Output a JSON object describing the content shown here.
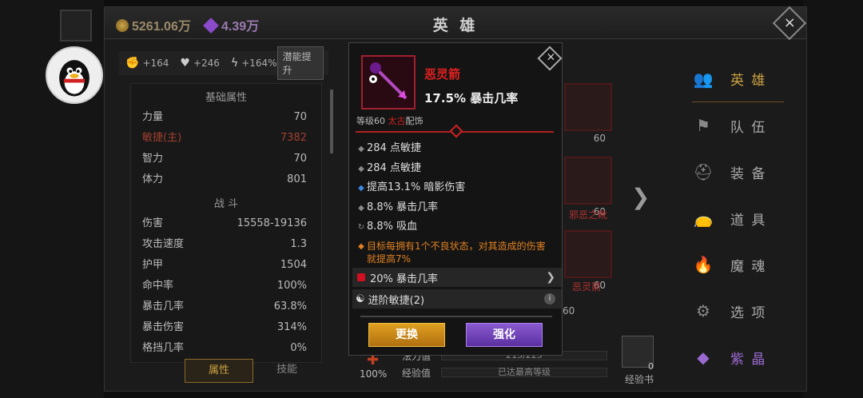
{
  "currency": {
    "gold": "5261.06万",
    "gems": "4.39万"
  },
  "header": {
    "title": "英 雄"
  },
  "stat_top": {
    "hp_bonus": "+164",
    "heart_bonus": "+246",
    "power_bonus": "+164%",
    "potential_button": "潜能提升"
  },
  "sections": {
    "basic": "基础属性",
    "battle": "战 斗"
  },
  "basic_stats": [
    {
      "name": "力量",
      "value": "70"
    },
    {
      "name": "敏捷(主)",
      "value": "7382"
    },
    {
      "name": "智力",
      "value": "70"
    },
    {
      "name": "体力",
      "value": "801"
    }
  ],
  "battle_stats": [
    {
      "name": "伤害",
      "value": "15558-19136"
    },
    {
      "name": "攻击速度",
      "value": "1.3"
    },
    {
      "name": "护甲",
      "value": "1504"
    },
    {
      "name": "命中率",
      "value": "100%"
    },
    {
      "name": "暴击几率",
      "value": "63.8%"
    },
    {
      "name": "暴击伤害",
      "value": "314%"
    },
    {
      "name": "格挡几率",
      "value": "0%"
    }
  ],
  "bottom_tabs": {
    "attributes": "属性",
    "skills": "技能"
  },
  "bg": {
    "slot_level": "60",
    "slot_name_1": "邪恶之靴",
    "slot_name_2": "恶灵箭",
    "pct": "100%",
    "mana_label": "法力值",
    "mana_value": "215/225",
    "exp_label": "经验值",
    "exp_value": "已达最高等级",
    "book_count": "0",
    "book_label": "经验书",
    "lower_lv": "60"
  },
  "menu": [
    {
      "label": "英 雄",
      "icon": "hero-icon"
    },
    {
      "label": "队 伍",
      "icon": "flag-icon"
    },
    {
      "label": "装 备",
      "icon": "helmet-icon"
    },
    {
      "label": "道 具",
      "icon": "bag-icon"
    },
    {
      "label": "魔 魂",
      "icon": "flame-icon"
    },
    {
      "label": "选 项",
      "icon": "gear-icon"
    },
    {
      "label": "紫 晶",
      "icon": "crystal-icon"
    }
  ],
  "item": {
    "name": "恶灵箭",
    "main_stat": "17.5% 暴击几率",
    "level_prefix": "等级60 ",
    "rarity": "太古",
    "slot": "配饰",
    "stats": [
      "284 点敏捷",
      "284 点敏捷",
      "提高13.1% 暗影伤害",
      "8.8% 暴击几率",
      "8.8% 吸血"
    ],
    "legendary": "目标每拥有1个不良状态，对其造成的伤害就提高7%",
    "gem": "20% 暴击几率",
    "advance": "进阶敏捷(2)",
    "swap_button": "更换",
    "upgrade_button": "强化"
  },
  "colors": {
    "rarity_red": "#d02020",
    "accent_gold": "#c9a040",
    "legendary_orange": "#e08020"
  }
}
